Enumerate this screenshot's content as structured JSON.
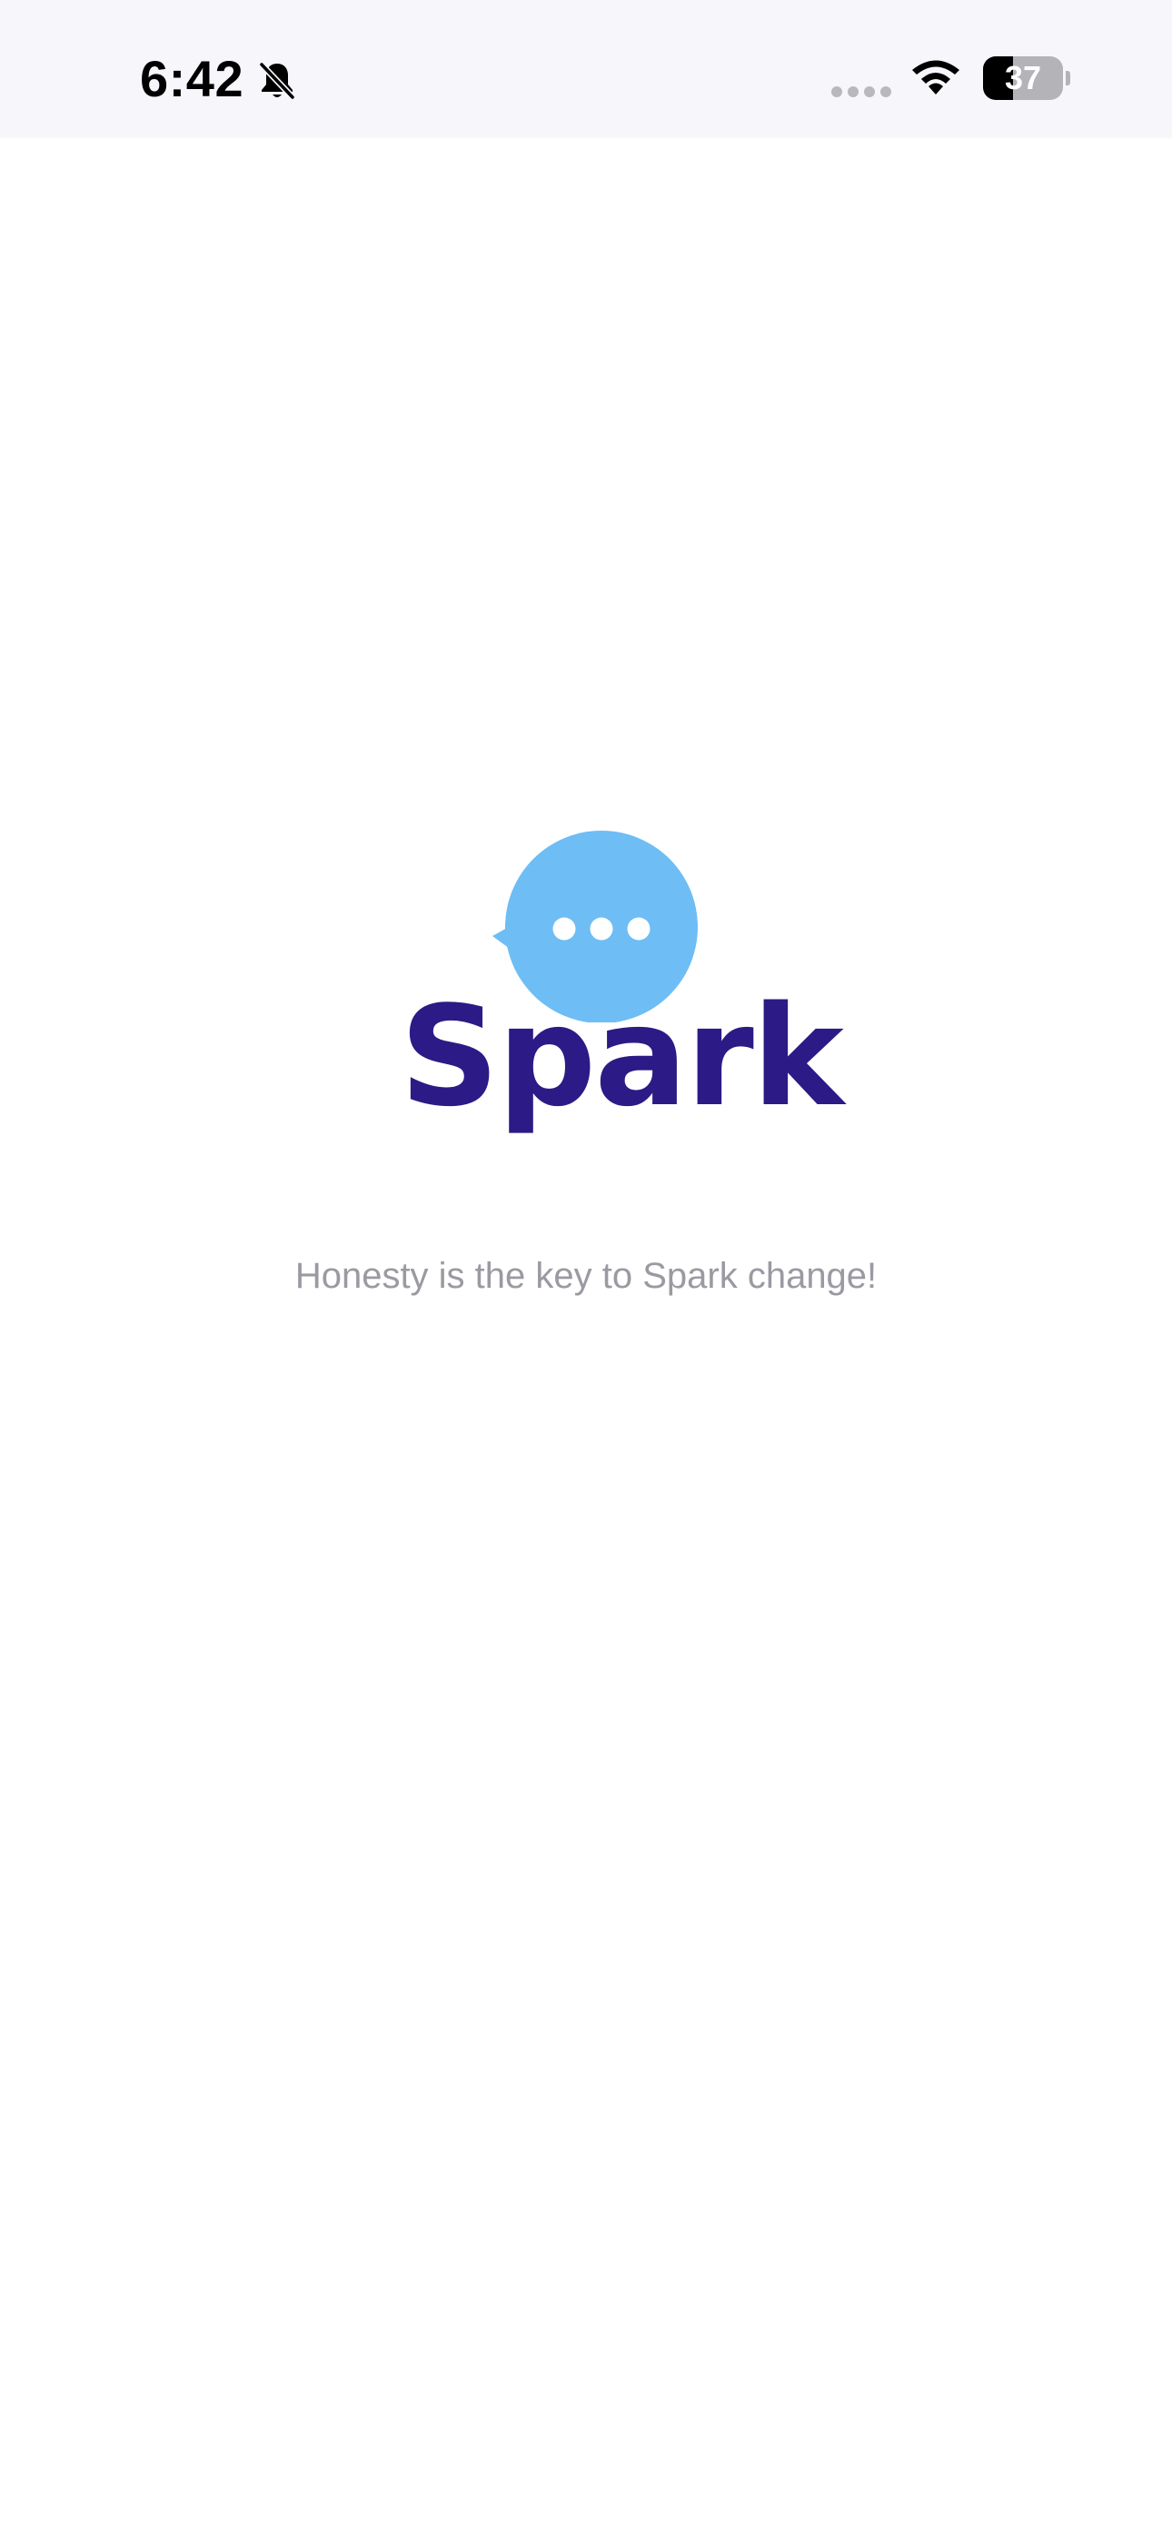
{
  "status_bar": {
    "time": "6:42",
    "battery_level": "37",
    "battery_fraction": 0.37,
    "icons": [
      "bell-slash-icon",
      "signal-icon",
      "wifi-icon",
      "battery-icon"
    ]
  },
  "splash": {
    "logo_text": "Spark",
    "tagline": "Honesty is the key to Spark change!"
  },
  "colors": {
    "status_bar_bg": "#f6f6fb",
    "background": "#ffffff",
    "bubble": "#6ebdf5",
    "brand": "#2c1a86",
    "tagline": "#9a9aa2"
  }
}
